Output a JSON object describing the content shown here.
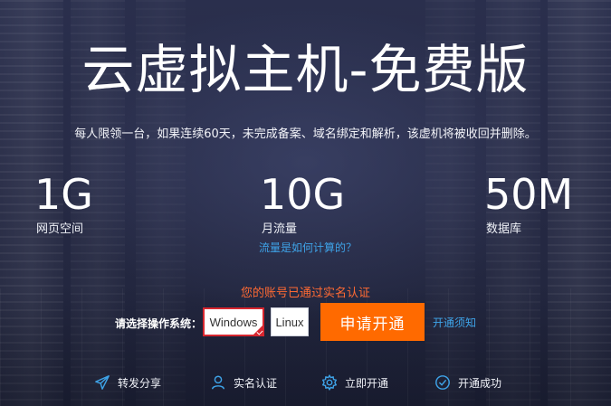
{
  "page": {
    "title": "云虚拟主机-免费版",
    "notice": "每人限领一台，如果连续60天，未完成备案、域名绑定和解析，该虚机将被收回并删除。"
  },
  "stats": [
    {
      "value": "1G",
      "label": "网页空间"
    },
    {
      "value": "10G",
      "label": "月流量"
    },
    {
      "value": "50M",
      "label": "数据库"
    }
  ],
  "flow_help_link": "流量是如何计算的？",
  "verification_status": "您的账号已通过实名认证",
  "os_select": {
    "label": "请选择操作系统：",
    "options": [
      "Windows",
      "Linux"
    ],
    "selected": "Windows"
  },
  "apply_button": "申请开通",
  "open_notice_link": "开通须知",
  "steps": [
    {
      "icon": "send-icon",
      "label": "转发分享"
    },
    {
      "icon": "user-icon",
      "label": "实名认证"
    },
    {
      "icon": "gear-icon",
      "label": "立即开通"
    },
    {
      "icon": "check-circle-icon",
      "label": "开通成功"
    }
  ],
  "colors": {
    "accent": "#ff6a00",
    "link": "#3ea3e8",
    "verified_text": "#ff6a33",
    "selected_border": "#d7262f",
    "step_icon": "#3ea3e8"
  }
}
